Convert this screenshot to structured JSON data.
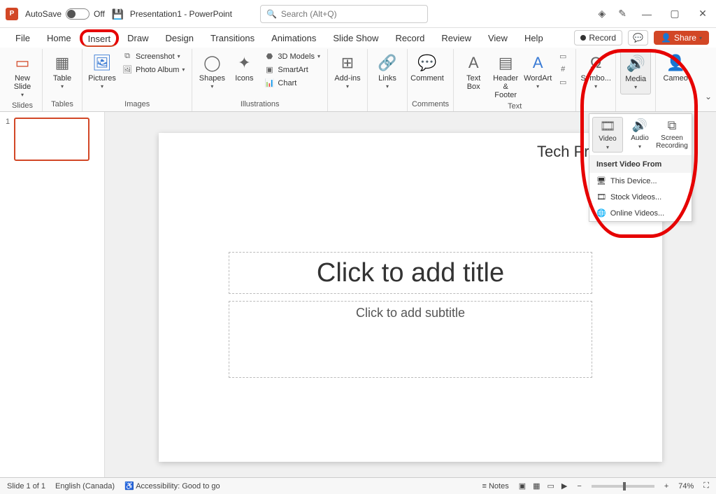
{
  "title": {
    "autosave_label": "AutoSave",
    "autosave_state": "Off",
    "document": "Presentation1 - PowerPoint",
    "search_placeholder": "Search (Alt+Q)"
  },
  "menu": {
    "tabs": [
      "File",
      "Home",
      "Insert",
      "Draw",
      "Design",
      "Transitions",
      "Animations",
      "Slide Show",
      "Record",
      "Review",
      "View",
      "Help"
    ],
    "active_tab": "Insert",
    "record": "Record",
    "share": "Share"
  },
  "ribbon": {
    "groups": {
      "slides": {
        "label": "Slides",
        "new_slide": "New Slide"
      },
      "tables": {
        "label": "Tables",
        "table": "Table"
      },
      "images": {
        "label": "Images",
        "pictures": "Pictures",
        "screenshot": "Screenshot",
        "photo_album": "Photo Album"
      },
      "illustrations": {
        "label": "Illustrations",
        "shapes": "Shapes",
        "icons": "Icons",
        "models": "3D Models",
        "smartart": "SmartArt",
        "chart": "Chart"
      },
      "addins": {
        "label": "",
        "addins": "Add-ins"
      },
      "links": {
        "label": "",
        "links": "Links"
      },
      "comments": {
        "label": "Comments",
        "comment": "Comment"
      },
      "text": {
        "label": "Text",
        "textbox": "Text Box",
        "header": "Header & Footer",
        "wordart": "WordArt"
      },
      "symbols": {
        "label": "",
        "symbols": "Symbo..."
      },
      "media": {
        "label": "",
        "media": "Media"
      },
      "cameo": {
        "label": "",
        "cameo": "Cameo"
      }
    }
  },
  "media_panel": {
    "video": "Video",
    "audio": "Audio",
    "screen_recording": "Screen Recording",
    "header": "Insert Video From",
    "options": [
      "This Device...",
      "Stock Videos...",
      "Online Videos..."
    ]
  },
  "slide": {
    "watermark": "Tech Presenters",
    "title_placeholder": "Click to add title",
    "subtitle_placeholder": "Click to add subtitle"
  },
  "thumbs": {
    "num": "1"
  },
  "status": {
    "slide_info": "Slide 1 of 1",
    "language": "English (Canada)",
    "accessibility": "Accessibility: Good to go",
    "notes": "Notes",
    "zoom": "74%"
  }
}
